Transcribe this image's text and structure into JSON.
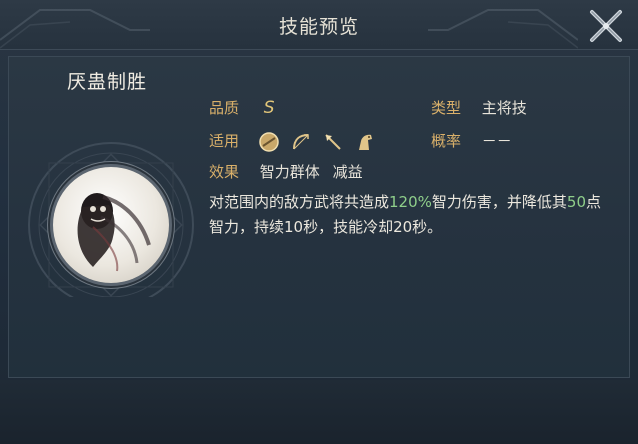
{
  "window": {
    "title": "技能预览"
  },
  "skill": {
    "name": "厌蛊制胜",
    "quality_label": "品质",
    "quality_value": "S",
    "type_label": "类型",
    "type_value": "主将技",
    "applies_label": "适用",
    "applies_icons": [
      "shield-icon",
      "bow-icon",
      "spear-icon",
      "horse-icon"
    ],
    "chance_label": "概率",
    "chance_value": "－－",
    "effect_label": "效果",
    "effect_tag_1": "智力群体",
    "effect_tag_2": "减益",
    "desc_part1": "对范围内的敌方武将共造成",
    "desc_highlight1": "120%",
    "desc_part2": "智力伤害，并降低其",
    "desc_highlight2": "50",
    "desc_part3": "点智力，持续10秒，技能冷却20秒。"
  },
  "colors": {
    "label": "#d9b06a",
    "highlight": "#8fcf8a",
    "text": "#ece8de",
    "background": "#223040"
  }
}
